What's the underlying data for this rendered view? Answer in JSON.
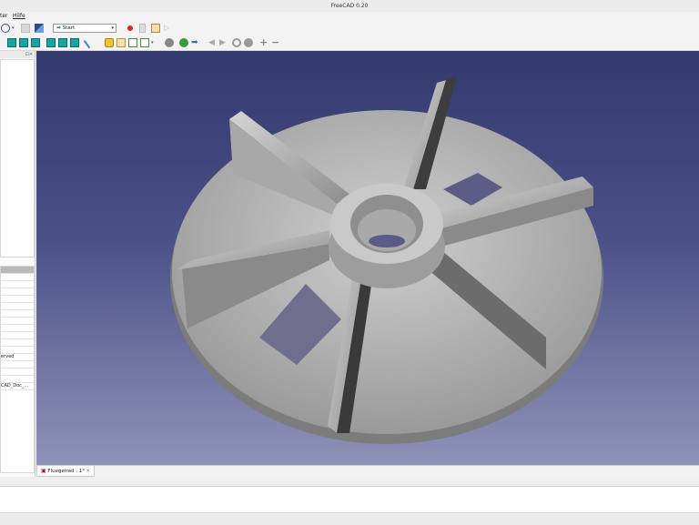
{
  "window": {
    "title": "FreeCAD 0.20"
  },
  "menubar": {
    "items": [
      "ter",
      "Hilfe"
    ]
  },
  "toolbar": {
    "workbench_value": "Start",
    "workbench_arrow": "➡",
    "dropdown_glyph": "▾"
  },
  "panel": {
    "controls": "⊡✕"
  },
  "property_view": {
    "values": [
      "erved",
      "CAD_Doc_..."
    ]
  },
  "document_tabs": [
    {
      "label": "Fluegelrad : 1*",
      "icon": "document-icon",
      "close": "✕"
    }
  ],
  "colors": {
    "viewport_top": "#333a6d",
    "viewport_bottom": "#8f92b8",
    "part_gray": "#b9b9b9"
  }
}
